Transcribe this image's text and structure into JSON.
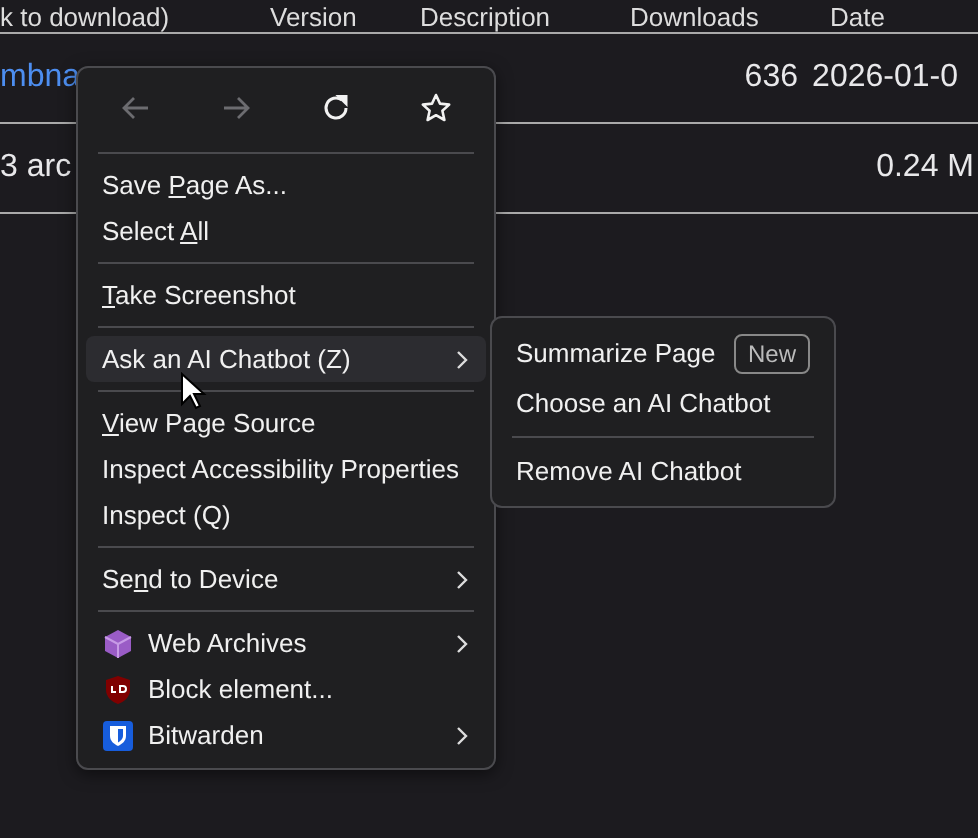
{
  "table": {
    "columns": [
      "k to download)",
      "Version",
      "Description",
      "Downloads",
      "Date"
    ],
    "rows": [
      {
        "name": "mbna",
        "link": true,
        "downloads": "636",
        "date": "2026-01-0"
      },
      {
        "name": "3 arc",
        "link": false,
        "size": "0.24 M"
      }
    ]
  },
  "context_menu": {
    "nav": [
      {
        "kind": "back",
        "disabled": true
      },
      {
        "kind": "forward",
        "disabled": true
      },
      {
        "kind": "reload",
        "disabled": false
      },
      {
        "kind": "bookmark",
        "disabled": false
      }
    ],
    "groups": [
      [
        {
          "kind": "plain",
          "pre": "Save ",
          "key": "P",
          "post": "age As...",
          "highlighted": false,
          "submenu": false
        },
        {
          "kind": "plain",
          "pre": "Select ",
          "key": "A",
          "post": "ll",
          "highlighted": false,
          "submenu": false
        }
      ],
      [
        {
          "kind": "plain",
          "key": "T",
          "post": "ake Screenshot",
          "highlighted": false,
          "submenu": false
        }
      ],
      [
        {
          "kind": "plain",
          "pre": "Ask an AI Chatbot (Z)",
          "highlighted": true,
          "submenu": true
        }
      ],
      [
        {
          "kind": "plain",
          "key": "V",
          "post": "iew Page Source",
          "highlighted": false,
          "submenu": false
        },
        {
          "kind": "plain",
          "pre": "Inspect Accessibility Properties",
          "highlighted": false,
          "submenu": false
        },
        {
          "kind": "plain",
          "pre": "Inspect (Q)",
          "highlighted": false,
          "submenu": false
        }
      ],
      [
        {
          "kind": "plain",
          "pre": "Se",
          "key": "n",
          "post": "d to Device",
          "highlighted": false,
          "submenu": true
        }
      ],
      [
        {
          "kind": "cube",
          "pre": "Web Archives",
          "highlighted": false,
          "submenu": true
        },
        {
          "kind": "shield",
          "pre": "Block element...",
          "highlighted": false,
          "submenu": false
        },
        {
          "kind": "vault",
          "pre": "Bitwarden",
          "highlighted": false,
          "submenu": true
        }
      ]
    ]
  },
  "submenu": {
    "groups": [
      [
        {
          "label": "Summarize Page",
          "badge": "New"
        },
        {
          "label": "Choose an AI Chatbot"
        }
      ],
      [
        {
          "label": "Remove AI Chatbot"
        }
      ]
    ]
  }
}
